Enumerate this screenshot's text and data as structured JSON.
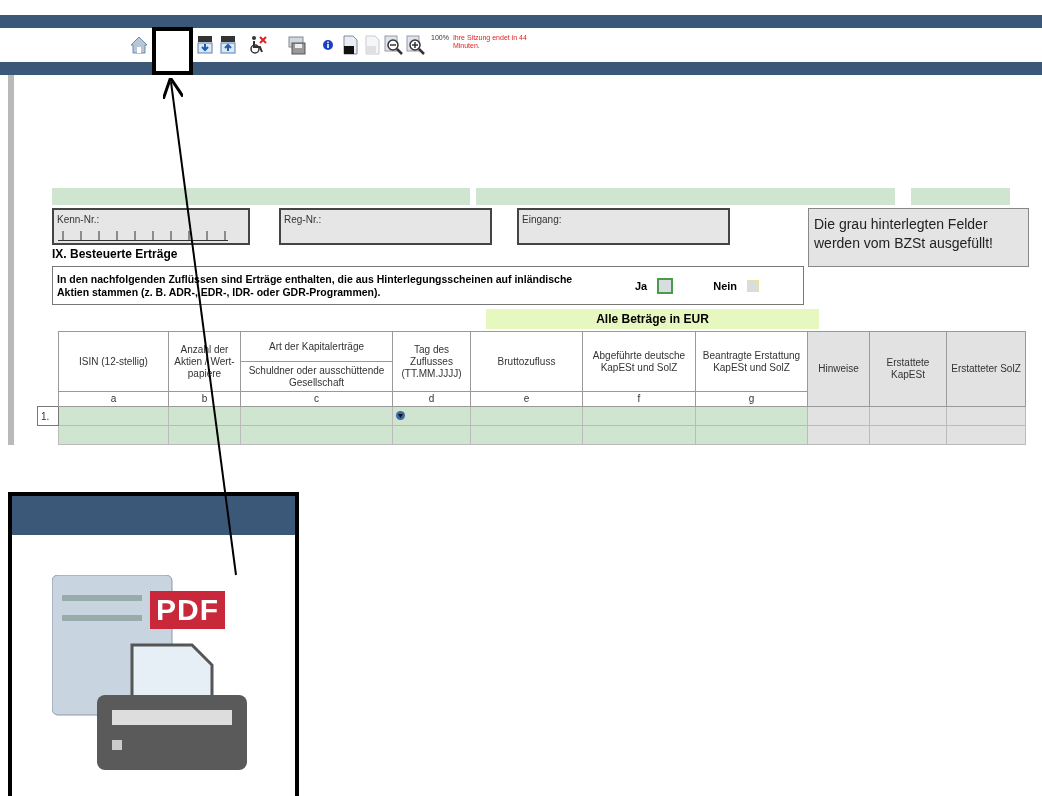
{
  "toolbar": {
    "zoom": "100%",
    "session_notice": "Ihre Sitzung endet in 44 Minuten."
  },
  "form": {
    "header_fields": [
      {
        "label": "Kenn-Nr.:",
        "kind": "ticks"
      },
      {
        "label": "Reg-Nr.:",
        "kind": "plain"
      },
      {
        "label": "Eingang:",
        "kind": "plain"
      }
    ],
    "note": "Die grau hinterlegten Felder werden vom BZSt ausgefüllt!",
    "section_title": "IX. Besteuerte Erträge",
    "question": {
      "text": "In den nachfolgenden Zuflüssen sind Erträge enthalten, die aus Hinterlegungsscheinen auf inländische Aktien stammen (z. B. ADR-, EDR-, IDR- oder GDR-Programmen).",
      "options": [
        {
          "label": "Ja",
          "checked": false,
          "focused": true
        },
        {
          "label": "Nein",
          "checked": false,
          "focused": false
        }
      ]
    },
    "currency_banner": "Alle Beträge in EUR",
    "table": {
      "columns": [
        {
          "title": "ISIN (12-stellig)",
          "letter": "a",
          "kind": "entry"
        },
        {
          "title": "Anzahl der Aktien / Wert-papiere",
          "letter": "b",
          "kind": "entry"
        },
        {
          "title": "Art der Kapitalerträge",
          "subtitle": "Schuldner oder ausschüttende Gesellschaft",
          "letter": "c",
          "kind": "entry"
        },
        {
          "title": "Tag des Zuflusses (TT.MM.JJJJ)",
          "letter": "d",
          "kind": "date"
        },
        {
          "title": "Bruttozufluss",
          "letter": "e",
          "kind": "entry"
        },
        {
          "title": "Abgeführte deutsche KapESt und SolZ",
          "letter": "f",
          "kind": "entry"
        },
        {
          "title": "Beantragte Erstattung KapESt und SolZ",
          "letter": "g",
          "kind": "entry"
        },
        {
          "title": "Hinweise",
          "kind": "office"
        },
        {
          "title": "Erstattete KapESt",
          "kind": "office"
        },
        {
          "title": "Erstatteter SolZ",
          "kind": "office"
        }
      ],
      "rows": [
        {
          "number": "1."
        }
      ]
    }
  },
  "inset": {
    "badge": "PDF"
  }
}
